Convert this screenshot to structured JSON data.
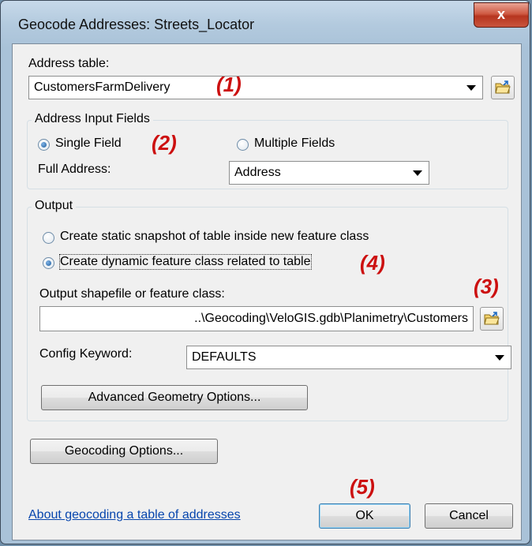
{
  "window": {
    "title": "Geocode Addresses:  Streets_Locator",
    "close_glyph": "x"
  },
  "address_table": {
    "label": "Address table:",
    "value": "CustomersFarmDelivery",
    "annotation": "(1)"
  },
  "address_input_fields": {
    "title": "Address Input Fields",
    "single_field_label": "Single Field",
    "annotation": "(2)",
    "multiple_fields_label": "Multiple Fields",
    "full_address_label": "Full Address:",
    "full_address_value": "Address"
  },
  "output": {
    "title": "Output",
    "static_snapshot_label": "Create static snapshot of table inside new feature class",
    "dynamic_feature_label": "Create dynamic feature class related to table",
    "annotation_dynamic": "(4)",
    "shapefile_label": "Output shapefile or feature class:",
    "annotation_browse": "(3)",
    "shapefile_value": "..\\Geocoding\\VeloGIS.gdb\\Planimetry\\Customers",
    "config_keyword_label": "Config Keyword:",
    "config_keyword_value": "DEFAULTS",
    "advanced_geometry_label": "Advanced Geometry Options..."
  },
  "footer": {
    "geocoding_options_label": "Geocoding Options...",
    "about_link": "About geocoding a table of addresses",
    "annotation_ok": "(5)",
    "ok_label": "OK",
    "cancel_label": "Cancel"
  },
  "colors": {
    "annotation": "#cc1010",
    "link": "#0645ad",
    "close_button": "#c9543d"
  },
  "icons": [
    "close-icon",
    "folder-open-icon",
    "chevron-down-icon"
  ]
}
